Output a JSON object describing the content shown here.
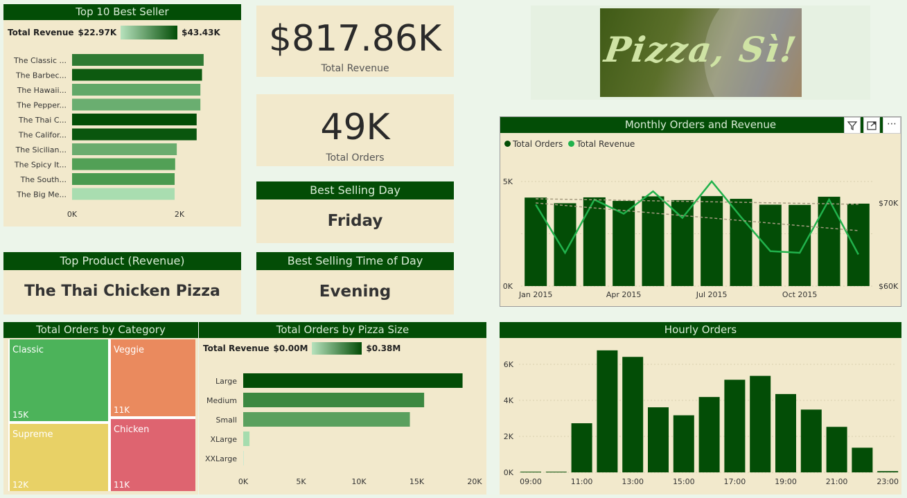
{
  "top10": {
    "title": "Top 10 Best Seller",
    "legend_label": "Total Revenue",
    "legend_min": "$22.97K",
    "legend_max": "$43.43K",
    "axis_ticks": [
      "0K",
      "2K"
    ],
    "items": [
      {
        "label": "The Classic ...",
        "color": "#2f7a33"
      },
      {
        "label": "The Barbec...",
        "color": "#0d5a10"
      },
      {
        "label": "The Hawaii...",
        "color": "#62a868"
      },
      {
        "label": "The Pepper...",
        "color": "#6aae70"
      },
      {
        "label": "The Thai C...",
        "color": "#034d06"
      },
      {
        "label": "The Califor...",
        "color": "#0a560e"
      },
      {
        "label": "The Sicilian...",
        "color": "#6aac6e"
      },
      {
        "label": "The Spicy It...",
        "color": "#52a056"
      },
      {
        "label": "The South...",
        "color": "#4a9a4f"
      },
      {
        "label": "The Big Me...",
        "color": "#a9ddb0"
      }
    ]
  },
  "kpi": {
    "revenue_value": "$817.86K",
    "revenue_label": "Total Revenue",
    "orders_value": "49K",
    "orders_label": "Total Orders",
    "best_day_title": "Best Selling Day",
    "best_day_value": "Friday",
    "best_time_title": "Best Selling Time of Day",
    "best_time_value": "Evening",
    "top_product_title": "Top Product (Revenue)",
    "top_product_value": "The Thai Chicken Pizza"
  },
  "logo": {
    "text": "Pizza, Sì!"
  },
  "monthly": {
    "title": "Monthly Orders and Revenue",
    "legend": [
      {
        "label": "Total Orders",
        "color": "#034d06"
      },
      {
        "label": "Total Revenue",
        "color": "#21b24c"
      }
    ],
    "y_left_ticks": [
      "5K",
      "0K"
    ],
    "y_right_ticks": [
      "$70K",
      "$60K"
    ],
    "x_ticks": [
      "Jan 2015",
      "Apr 2015",
      "Jul 2015",
      "Oct 2015"
    ],
    "toolbar_icons": [
      "filter-icon",
      "focus-mode-icon",
      "more-options-icon"
    ]
  },
  "category": {
    "title": "Total Orders by Category",
    "tiles": [
      {
        "name": "Classic",
        "value": "15K",
        "color": "#4cb35a"
      },
      {
        "name": "Veggie",
        "value": "11K",
        "color": "#ea8a5e"
      },
      {
        "name": "Supreme",
        "value": "12K",
        "color": "#e8d166"
      },
      {
        "name": "Chicken",
        "value": "11K",
        "color": "#de6470"
      }
    ]
  },
  "size": {
    "title": "Total Orders by Pizza Size",
    "legend_label": "Total Revenue",
    "legend_min": "$0.00M",
    "legend_max": "$0.38M",
    "x_ticks": [
      "0K",
      "5K",
      "10K",
      "15K",
      "20K"
    ]
  },
  "hourly": {
    "title": "Hourly Orders",
    "y_ticks": [
      "6K",
      "4K",
      "2K",
      "0K"
    ],
    "x_ticks": [
      "09:00",
      "11:00",
      "13:00",
      "15:00",
      "17:00",
      "19:00",
      "21:00",
      "23:00"
    ]
  },
  "chart_data": [
    {
      "type": "bar",
      "title": "Top 10 Best Seller",
      "categories": [
        "The Classic ...",
        "The Barbec...",
        "The Hawaii...",
        "The Pepper...",
        "The Thai C...",
        "The Califor...",
        "The Sicilian...",
        "The Spicy It...",
        "The South...",
        "The Big Me..."
      ],
      "values": [
        2450,
        2420,
        2390,
        2390,
        2320,
        2320,
        1950,
        1920,
        1910,
        1910
      ],
      "xlim": [
        0,
        3000
      ]
    },
    {
      "type": "bar",
      "title": "Monthly Orders and Revenue",
      "categories": [
        "Jan 2015",
        "Feb 2015",
        "Mar 2015",
        "Apr 2015",
        "May 2015",
        "Jun 2015",
        "Jul 2015",
        "Aug 2015",
        "Sep 2015",
        "Oct 2015",
        "Nov 2015",
        "Dec 2015"
      ],
      "series": [
        {
          "name": "Total Orders",
          "values": [
            4230,
            3960,
            4240,
            4070,
            4290,
            4110,
            4300,
            4170,
            3890,
            3880,
            4270,
            3940
          ]
        },
        {
          "name": "Total Revenue",
          "values": [
            69800,
            64000,
            70400,
            68700,
            71400,
            68200,
            72600,
            68300,
            64200,
            64000,
            70400,
            63800
          ]
        }
      ],
      "ylim_left": [
        0,
        5000
      ],
      "ylim_right": [
        60000,
        70000
      ]
    },
    {
      "type": "heatmap",
      "title": "Total Orders by Category",
      "categories": [
        "Classic",
        "Veggie",
        "Supreme",
        "Chicken"
      ],
      "values": [
        15000,
        11000,
        12000,
        11000
      ]
    },
    {
      "type": "bar",
      "title": "Total Orders by Pizza Size",
      "categories": [
        "Large",
        "Medium",
        "Small",
        "XLarge",
        "XXLarge"
      ],
      "values": [
        18956,
        15635,
        14403,
        544,
        28
      ],
      "xlim": [
        0,
        20000
      ]
    },
    {
      "type": "bar",
      "title": "Hourly Orders",
      "categories": [
        "09:00",
        "10:00",
        "11:00",
        "12:00",
        "13:00",
        "14:00",
        "15:00",
        "16:00",
        "17:00",
        "18:00",
        "19:00",
        "20:00",
        "21:00",
        "22:00",
        "23:00"
      ],
      "values": [
        4,
        18,
        2728,
        6776,
        6413,
        3613,
        3170,
        4185,
        5143,
        5359,
        4350,
        3487,
        2528,
        1370,
        68
      ],
      "ylim": [
        0,
        7000
      ]
    }
  ]
}
